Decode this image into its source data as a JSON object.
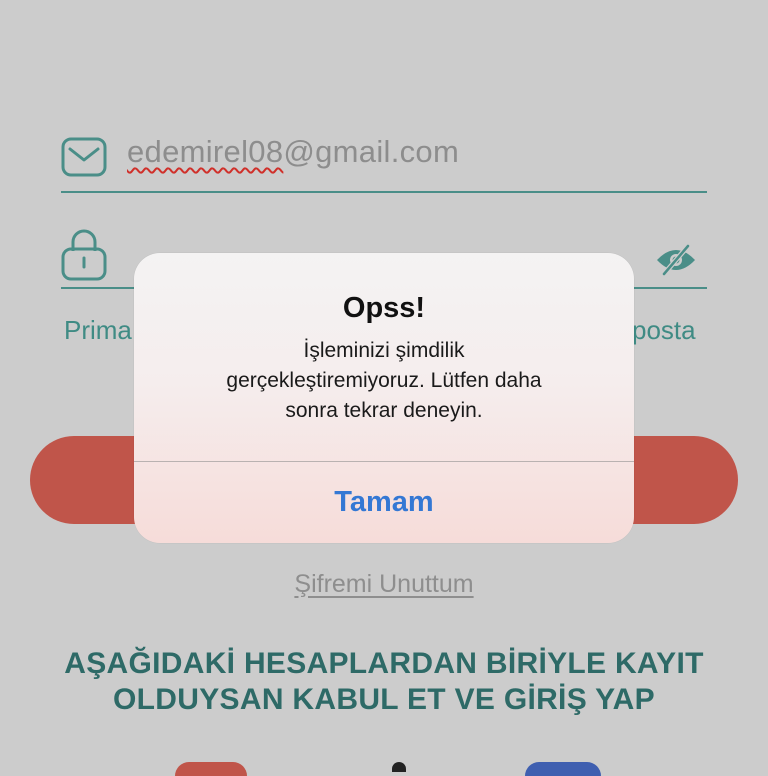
{
  "login": {
    "email_local": "edemirel08",
    "email_domain": "@gmail.com",
    "remember_partial": "Prima",
    "right_partial": "posta"
  },
  "forgot_password_link": "Şifremi Unuttum",
  "social_heading_line1": "AŞAĞIDAKİ HESAPLARDAN BİRİYLE KAYIT",
  "social_heading_line2": "OLDUYSAN KABUL ET VE GİRİŞ YAP",
  "dialog": {
    "title": "Opss!",
    "message_line1": "İşleminizi şimdilik",
    "message_line2": "gerçekleştiremiyoruz. Lütfen daha",
    "message_line3": "sonra tekrar deneyin.",
    "ok_button": "Tamam"
  },
  "icons": {
    "email": "envelope-icon",
    "password": "lock-icon",
    "visibility": "eye-slash-icon"
  },
  "colors": {
    "background": "#cccccc",
    "accent_teal": "#4a8e88",
    "primary_button": "#c0554a",
    "heading": "#2e6a67",
    "dialog_link": "#3478d4"
  }
}
